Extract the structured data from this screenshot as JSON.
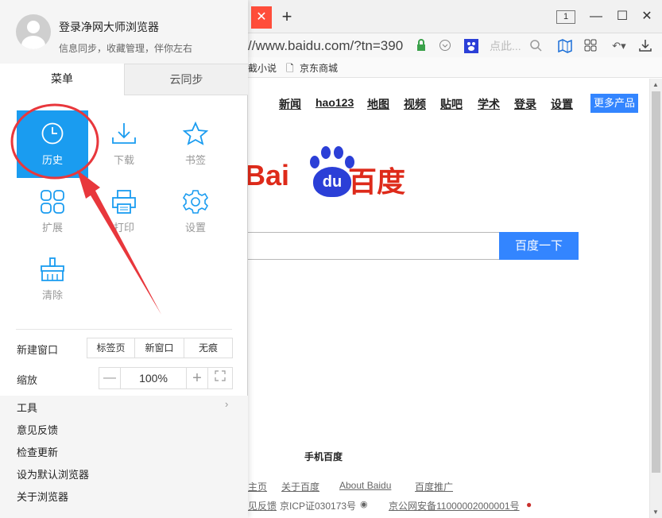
{
  "browser": {
    "tab_close_icon": "close-icon",
    "tab_count": "1",
    "url": "//www.baidu.com/?tn=390",
    "search_placeholder": "点此...",
    "bookmarks": [
      "截小说",
      "京东商城"
    ]
  },
  "baidu": {
    "nav_links": [
      "新闻",
      "hao123",
      "地图",
      "视频",
      "贴吧",
      "学术",
      "登录",
      "设置"
    ],
    "more_products": "更多产品",
    "logo_text_left": "Bai",
    "logo_paw_text": "du",
    "logo_text_right": "百度",
    "search_button": "百度一下",
    "mobile_link": "手机百度",
    "footer_links": [
      "主页",
      "关于百度",
      "About Baidu",
      "百度推广"
    ],
    "footer_feedback": "见反馈",
    "icp": "京ICP证030173号",
    "police": "京公网安备11000002000001号"
  },
  "menu_panel": {
    "user_title": "登录净网大师浏览器",
    "user_subtitle": "信息同步，收藏管理，伴你左右",
    "tabs": [
      "菜单",
      "云同步"
    ],
    "grid": [
      {
        "label": "历史",
        "icon": "clock-icon"
      },
      {
        "label": "下载",
        "icon": "download-icon"
      },
      {
        "label": "书签",
        "icon": "star-icon"
      },
      {
        "label": "扩展",
        "icon": "extensions-icon"
      },
      {
        "label": "打印",
        "icon": "printer-icon"
      },
      {
        "label": "设置",
        "icon": "gear-icon"
      },
      {
        "label": "清除",
        "icon": "broom-icon"
      }
    ],
    "new_window": {
      "label": "新建窗口",
      "options": [
        "标签页",
        "新窗口",
        "无痕"
      ]
    },
    "zoom": {
      "label": "缩放",
      "minus": "—",
      "value": "100%",
      "plus": "+"
    },
    "list": [
      "工具",
      "意见反馈",
      "检查更新",
      "设为默认浏览器",
      "关于浏览器"
    ]
  },
  "colors": {
    "accent": "#1a9cf0",
    "annotation": "#e8373c",
    "baidu_blue": "#3385ff",
    "baidu_red": "#de2a1a"
  }
}
